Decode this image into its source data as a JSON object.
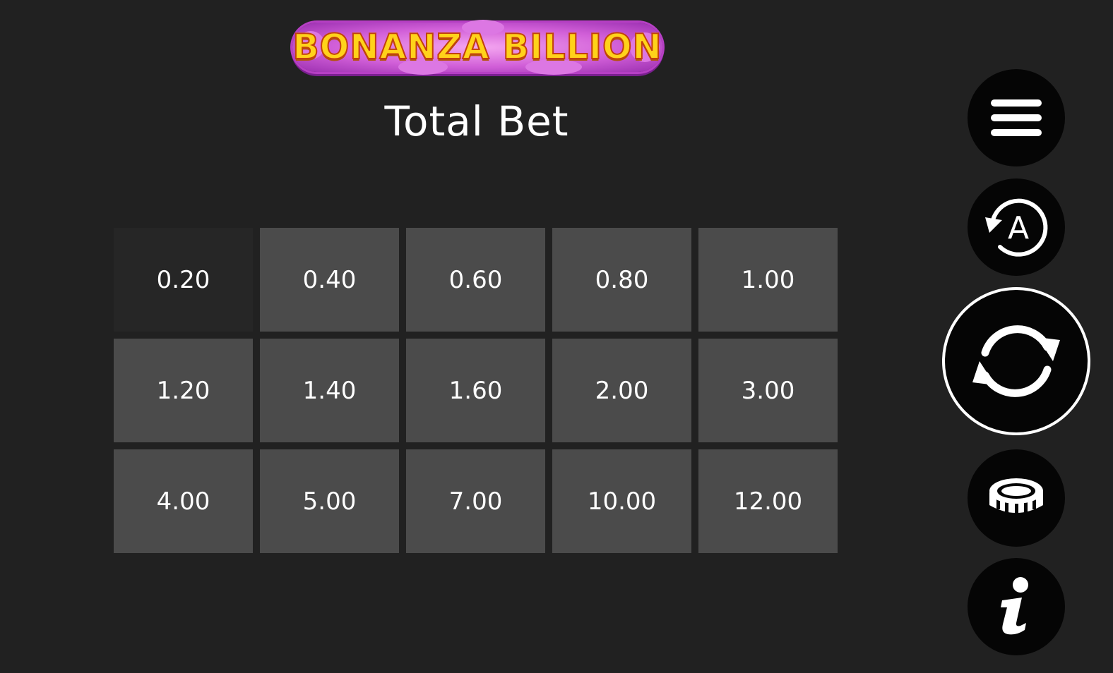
{
  "header": {
    "logo_text": "BONANZA BILLION",
    "title": "Total Bet"
  },
  "bet_options": [
    {
      "label": "0.20",
      "selected": true
    },
    {
      "label": "0.40",
      "selected": false
    },
    {
      "label": "0.60",
      "selected": false
    },
    {
      "label": "0.80",
      "selected": false
    },
    {
      "label": "1.00",
      "selected": false
    },
    {
      "label": "1.20",
      "selected": false
    },
    {
      "label": "1.40",
      "selected": false
    },
    {
      "label": "1.60",
      "selected": false
    },
    {
      "label": "2.00",
      "selected": false
    },
    {
      "label": "3.00",
      "selected": false
    },
    {
      "label": "4.00",
      "selected": false
    },
    {
      "label": "5.00",
      "selected": false
    },
    {
      "label": "7.00",
      "selected": false
    },
    {
      "label": "10.00",
      "selected": false
    },
    {
      "label": "12.00",
      "selected": false
    }
  ],
  "controls": {
    "menu_icon": "hamburger-menu-icon",
    "autoplay_icon": "autoplay-icon",
    "autoplay_letter": "A",
    "spin_icon": "spin-arrows-icon",
    "bet_icon": "coin-stack-icon",
    "info_icon": "info-icon"
  },
  "colors": {
    "background": "#212121",
    "cell": "#4b4b4b",
    "cell_selected": "#262626",
    "button": "#050505",
    "logo_text": "#ffd21a",
    "logo_frame": "#d15fd8"
  }
}
